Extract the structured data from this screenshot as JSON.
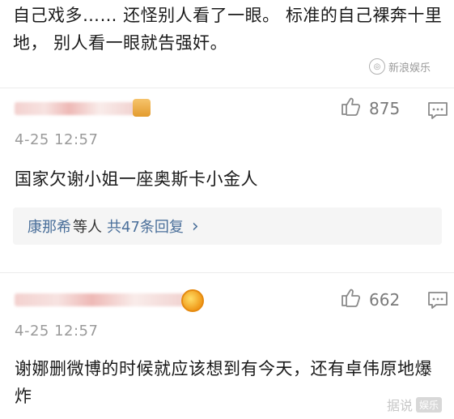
{
  "top_comment": {
    "text": "自己戏多…… 还怪别人看了一眼。 标准的自己裸奔十里地， 别人看一眼就告强奸。"
  },
  "watermark_top": {
    "text": "新浪娱乐"
  },
  "comments": [
    {
      "likes": "875",
      "time": "4-25 12:57",
      "text": "国家欠谢小姐一座奥斯卡小金人",
      "reply": {
        "users": "康那希",
        "mid": "等人",
        "count_label": "共47条回复",
        "chevron": "›"
      }
    },
    {
      "likes": "662",
      "time": "4-25 12:57",
      "text": "谢娜删微博的时候就应该想到有今天，还有卓伟原地爆炸"
    }
  ],
  "watermark_bottom": {
    "text": "据说",
    "tag": "娱乐"
  },
  "icons": {
    "like": "thumbs-up-icon",
    "comment": "comment-icon"
  },
  "colors": {
    "link": "#4a6f9a",
    "time": "#9a9a9a",
    "reply_bg": "#f5f5f5"
  }
}
